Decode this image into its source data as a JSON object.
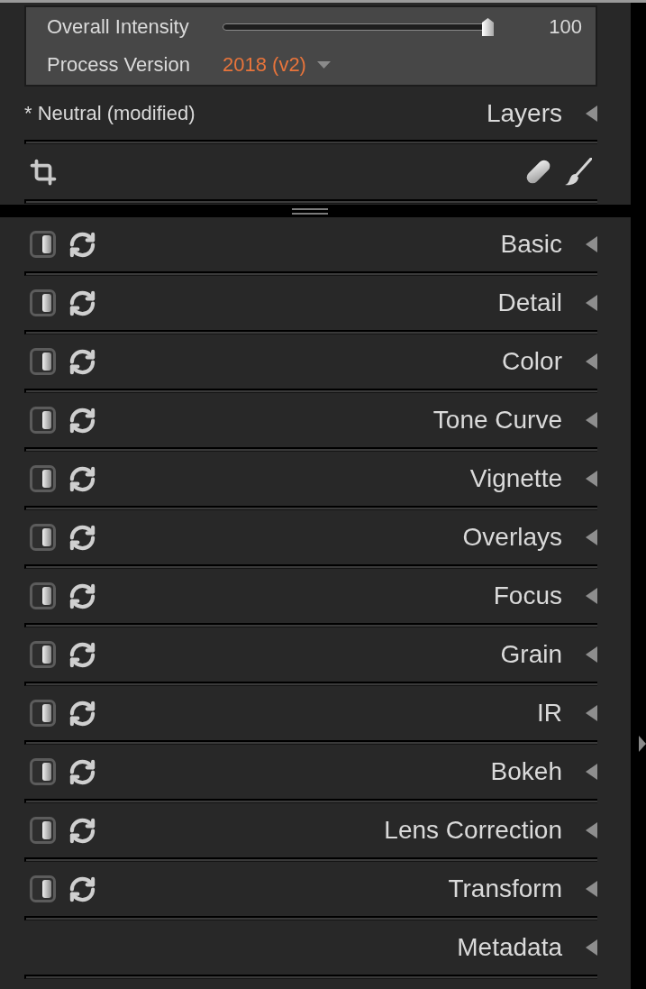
{
  "intensity_panel": {
    "slider": {
      "label": "Overall Intensity",
      "level": 1,
      "reading": "100"
    },
    "process_version": {
      "label": "Process Version",
      "value": "2018 (v2)"
    }
  },
  "preset_bar": {
    "preset": "* Neutral (modified)",
    "title": "Layers",
    "expanded": false
  },
  "panels": [
    {
      "title": "Basic",
      "kind": "adjustment",
      "expanded": false
    },
    {
      "title": "Detail",
      "kind": "adjustment",
      "expanded": false
    },
    {
      "title": "Color",
      "kind": "adjustment",
      "expanded": false
    },
    {
      "title": "Tone Curve",
      "kind": "adjustment",
      "expanded": false
    },
    {
      "title": "Vignette",
      "kind": "adjustment",
      "expanded": false
    },
    {
      "title": "Overlays",
      "kind": "adjustment",
      "expanded": false
    },
    {
      "title": "Focus",
      "kind": "adjustment",
      "expanded": false
    },
    {
      "title": "Grain",
      "kind": "adjustment",
      "expanded": false
    },
    {
      "title": "IR",
      "kind": "adjustment",
      "expanded": false
    },
    {
      "title": "Bokeh",
      "kind": "adjustment",
      "expanded": false
    },
    {
      "title": "Lens Correction",
      "kind": "adjustment",
      "expanded": false
    },
    {
      "title": "Transform",
      "kind": "adjustment",
      "expanded": false
    },
    {
      "title": "Metadata",
      "kind": "info",
      "expanded": false
    }
  ]
}
